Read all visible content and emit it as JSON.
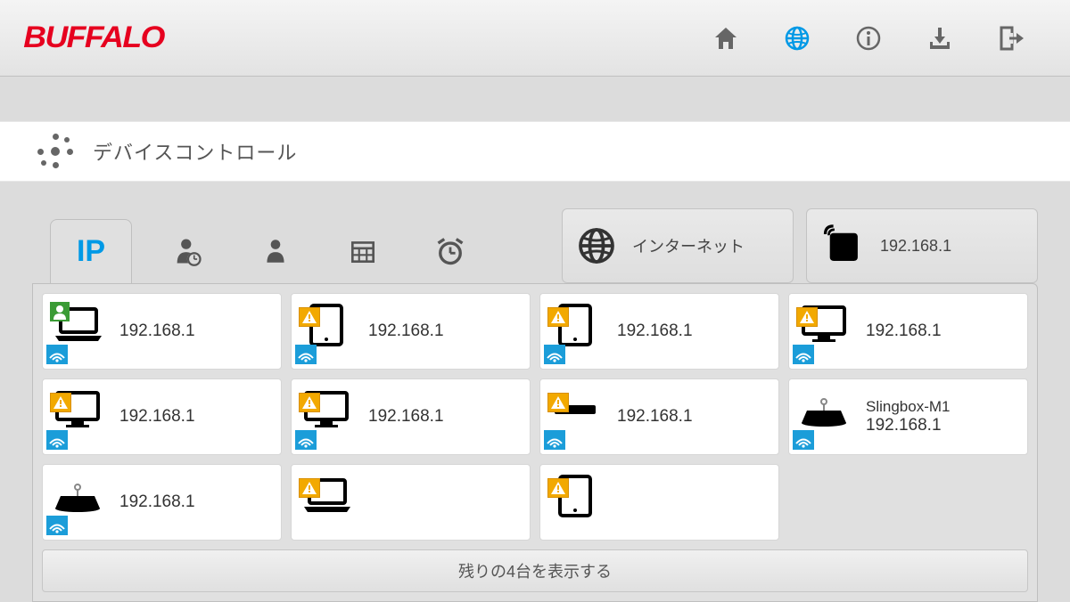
{
  "brand": "BUFFALO",
  "section_title": "デバイスコントロール",
  "tabs": {
    "ip_label": "IP"
  },
  "internet_box": {
    "label": "インターネット"
  },
  "router_box": {
    "ip": "192.168.1"
  },
  "devices": [
    {
      "name": "",
      "ip": "192.168.1",
      "type": "laptop",
      "user": true,
      "warn": false,
      "wifi": true
    },
    {
      "name": "",
      "ip": "192.168.1",
      "type": "tablet",
      "user": false,
      "warn": true,
      "wifi": true
    },
    {
      "name": "",
      "ip": "192.168.1",
      "type": "tablet",
      "user": false,
      "warn": true,
      "wifi": true
    },
    {
      "name": "",
      "ip": "192.168.1",
      "type": "monitor",
      "user": false,
      "warn": true,
      "wifi": true
    },
    {
      "name": "",
      "ip": "192.168.1",
      "type": "monitor",
      "user": false,
      "warn": true,
      "wifi": true
    },
    {
      "name": "",
      "ip": "192.168.1",
      "type": "monitor",
      "user": false,
      "warn": true,
      "wifi": true
    },
    {
      "name": "",
      "ip": "192.168.1",
      "type": "console",
      "user": false,
      "warn": true,
      "wifi": true
    },
    {
      "name": "Slingbox-M1",
      "ip": "192.168.1",
      "type": "box",
      "user": false,
      "warn": false,
      "wifi": true
    },
    {
      "name": "",
      "ip": "192.168.1",
      "type": "box",
      "user": false,
      "warn": false,
      "wifi": true
    },
    {
      "name": "",
      "ip": "",
      "type": "laptop",
      "user": false,
      "warn": true,
      "wifi": false
    },
    {
      "name": "",
      "ip": "",
      "type": "tablet",
      "user": false,
      "warn": true,
      "wifi": false
    }
  ],
  "more_label": "残りの4台を表示する"
}
